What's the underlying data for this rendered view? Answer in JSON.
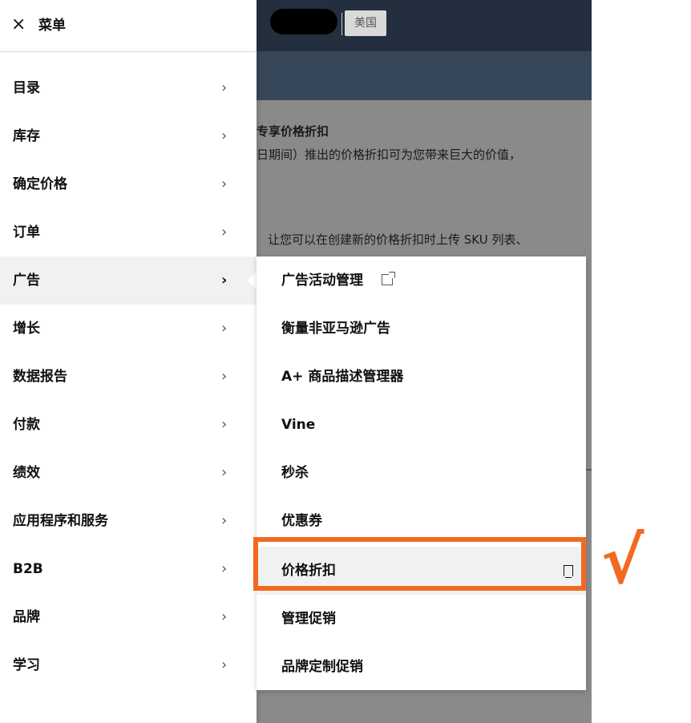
{
  "page": {
    "store_label": "美国",
    "heading_partial": "专享价格折扣",
    "text_partial_1": "日期间）推出的价格折扣可为您带来巨大的价值，",
    "text_partial_2": "让您可以在创建新的价格折扣时上传 SKU 列表、"
  },
  "menu": {
    "title": "菜单",
    "close_icon": "×",
    "chevron": "›",
    "items": [
      {
        "label": "目录"
      },
      {
        "label": "库存"
      },
      {
        "label": "确定价格"
      },
      {
        "label": "订单"
      },
      {
        "label": "广告",
        "active": true
      },
      {
        "label": "增长"
      },
      {
        "label": "数据报告"
      },
      {
        "label": "付款"
      },
      {
        "label": "绩效"
      },
      {
        "label": "应用程序和服务"
      },
      {
        "label": "B2B"
      },
      {
        "label": "品牌"
      },
      {
        "label": "学习"
      }
    ]
  },
  "submenu": {
    "items": [
      {
        "label": "广告活动管理",
        "icon": "external-link-icon"
      },
      {
        "label": "衡量非亚马逊广告"
      },
      {
        "label": "A+ 商品描述管理器"
      },
      {
        "label": "Vine"
      },
      {
        "label": "秒杀"
      },
      {
        "label": "优惠券"
      },
      {
        "label": "价格折扣",
        "icon": "bookmark-icon",
        "selected": true
      },
      {
        "label": "管理促销"
      },
      {
        "label": "品牌定制促销"
      }
    ]
  },
  "annotation": {
    "check_mark": "√",
    "color": "#f26a22"
  }
}
